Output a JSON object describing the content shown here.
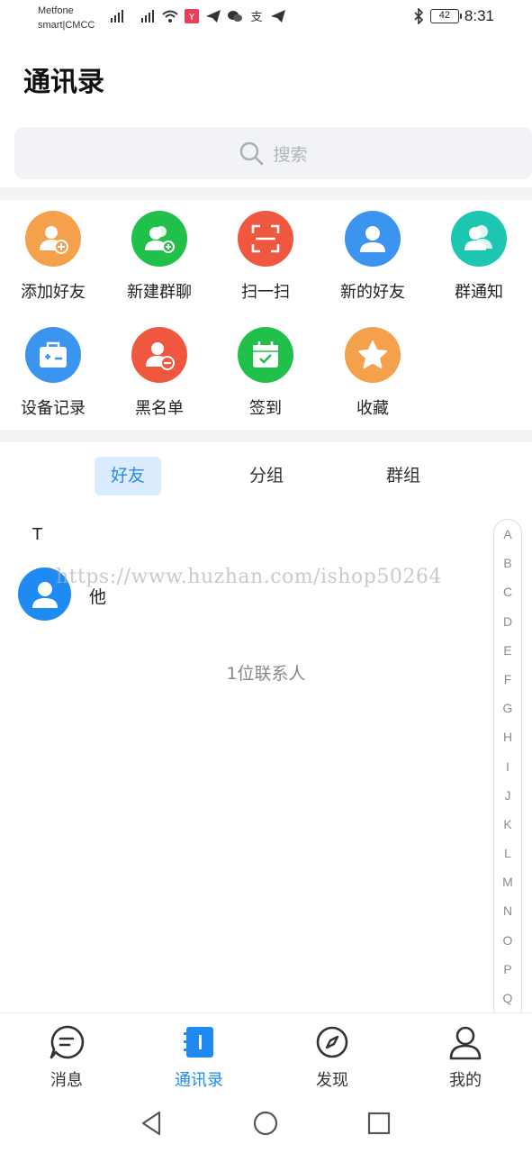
{
  "status": {
    "carrier_line1": "Metfone",
    "carrier_line2": "smart|CMCC",
    "battery": "42",
    "time": "8:31"
  },
  "header": {
    "title": "通讯录"
  },
  "search": {
    "placeholder": "搜索"
  },
  "features": [
    {
      "label": "添加好友",
      "icon": "add-friend-icon",
      "color": "#f5a04a"
    },
    {
      "label": "新建群聊",
      "icon": "new-group-icon",
      "color": "#21c04a"
    },
    {
      "label": "扫一扫",
      "icon": "scan-icon",
      "color": "#f0573f"
    },
    {
      "label": "新的好友",
      "icon": "new-friend-icon",
      "color": "#3a94f0"
    },
    {
      "label": "群通知",
      "icon": "group-notice-icon",
      "color": "#1cc6b0"
    },
    {
      "label": "设备记录",
      "icon": "device-record-icon",
      "color": "#3a94f0"
    },
    {
      "label": "黑名单",
      "icon": "blacklist-icon",
      "color": "#f0573f"
    },
    {
      "label": "签到",
      "icon": "check-in-icon",
      "color": "#21c04a"
    },
    {
      "label": "收藏",
      "icon": "favorite-icon",
      "color": "#f5a04a"
    }
  ],
  "tabs": [
    {
      "label": "好友",
      "active": true
    },
    {
      "label": "分组",
      "active": false
    },
    {
      "label": "群组",
      "active": false
    }
  ],
  "contacts": {
    "section": "T",
    "items": [
      {
        "name": "他"
      }
    ],
    "count_text": "1位联系人"
  },
  "watermark": "https://www.huzhan.com/ishop50264",
  "index_letters": [
    "A",
    "B",
    "C",
    "D",
    "E",
    "F",
    "G",
    "H",
    "I",
    "J",
    "K",
    "L",
    "M",
    "N",
    "O",
    "P",
    "Q"
  ],
  "bottom_nav": [
    {
      "label": "消息",
      "icon": "message-icon",
      "active": false
    },
    {
      "label": "通讯录",
      "icon": "contacts-icon",
      "active": true
    },
    {
      "label": "发现",
      "icon": "compass-icon",
      "active": false
    },
    {
      "label": "我的",
      "icon": "profile-icon",
      "active": false
    }
  ],
  "colors": {
    "accent": "#1e8af2",
    "tab_active_bg": "#dcecff"
  }
}
